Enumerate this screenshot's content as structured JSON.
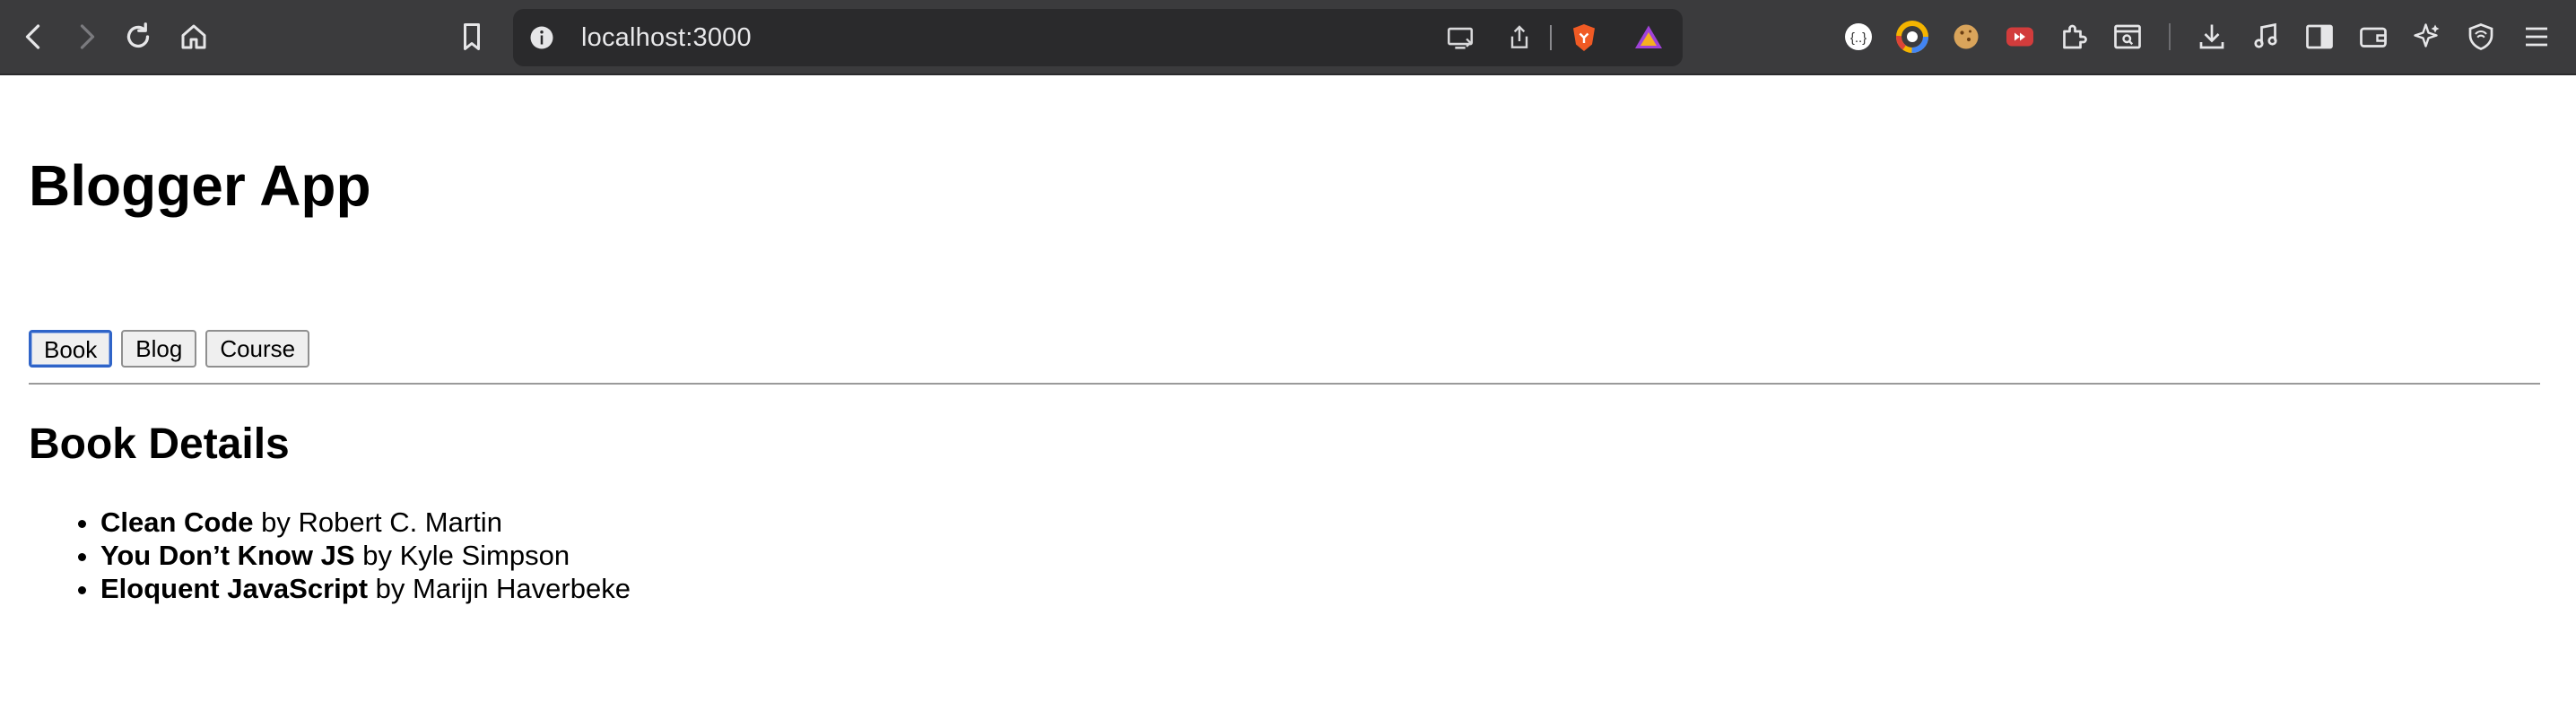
{
  "browser": {
    "url": "localhost:3000"
  },
  "page": {
    "title": "Blogger App",
    "nav": {
      "book_label": "Book",
      "blog_label": "Blog",
      "course_label": "Course",
      "selected": "Book"
    },
    "section_title": "Book Details",
    "books": [
      {
        "title": "Clean Code",
        "by": "by",
        "author": "Robert C. Martin"
      },
      {
        "title": "You Don’t Know JS",
        "by": "by",
        "author": "Kyle Simpson"
      },
      {
        "title": "Eloquent JavaScript",
        "by": "by",
        "author": "Marijn Haverbeke"
      }
    ]
  },
  "colors": {
    "toolbar_bg": "#3b3b3d",
    "urlbar_bg": "#2a2a2c",
    "active_button_border": "#2f64c8"
  }
}
